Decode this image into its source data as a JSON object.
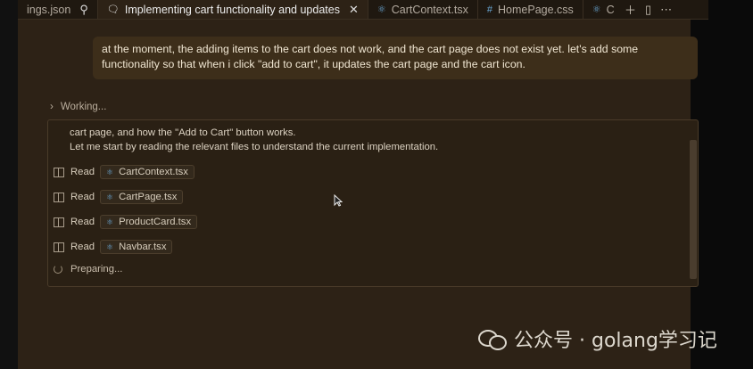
{
  "tabs": [
    {
      "label": "ings.json",
      "icon": "pin-icon"
    },
    {
      "label": "Implementing cart functionality and updates",
      "icon": "chat-icon",
      "active": true
    },
    {
      "label": "CartContext.tsx",
      "icon": "react-icon"
    },
    {
      "label": "HomePage.css",
      "icon": "hash-icon"
    },
    {
      "label": "C",
      "icon": "react-icon"
    }
  ],
  "tab_actions": [
    "plus-icon",
    "split-icon",
    "more-icon"
  ],
  "user_message": "at the moment, the adding items to the cart does not work, and the cart page does not exist yet. let's add some functionality so that when i click \"add to cart\", it updates the cart page and the cart icon.",
  "working_label": "Working...",
  "panel": {
    "truncated_line": "cart page, and how the \"Add to Cart\" button works.",
    "intro_line": "Let me start by reading the relevant files to understand the current implementation.",
    "reads": [
      {
        "label": "Read",
        "file": "CartContext.tsx"
      },
      {
        "label": "Read",
        "file": "CartPage.tsx"
      },
      {
        "label": "Read",
        "file": "ProductCard.tsx"
      },
      {
        "label": "Read",
        "file": "Navbar.tsx"
      }
    ],
    "preparing": "Preparing..."
  },
  "watermark": "公众号 · golang学习记",
  "colors": {
    "background": "#2d2216",
    "message_bg": "#3d2e1a",
    "accent": "#6aa8d6"
  }
}
